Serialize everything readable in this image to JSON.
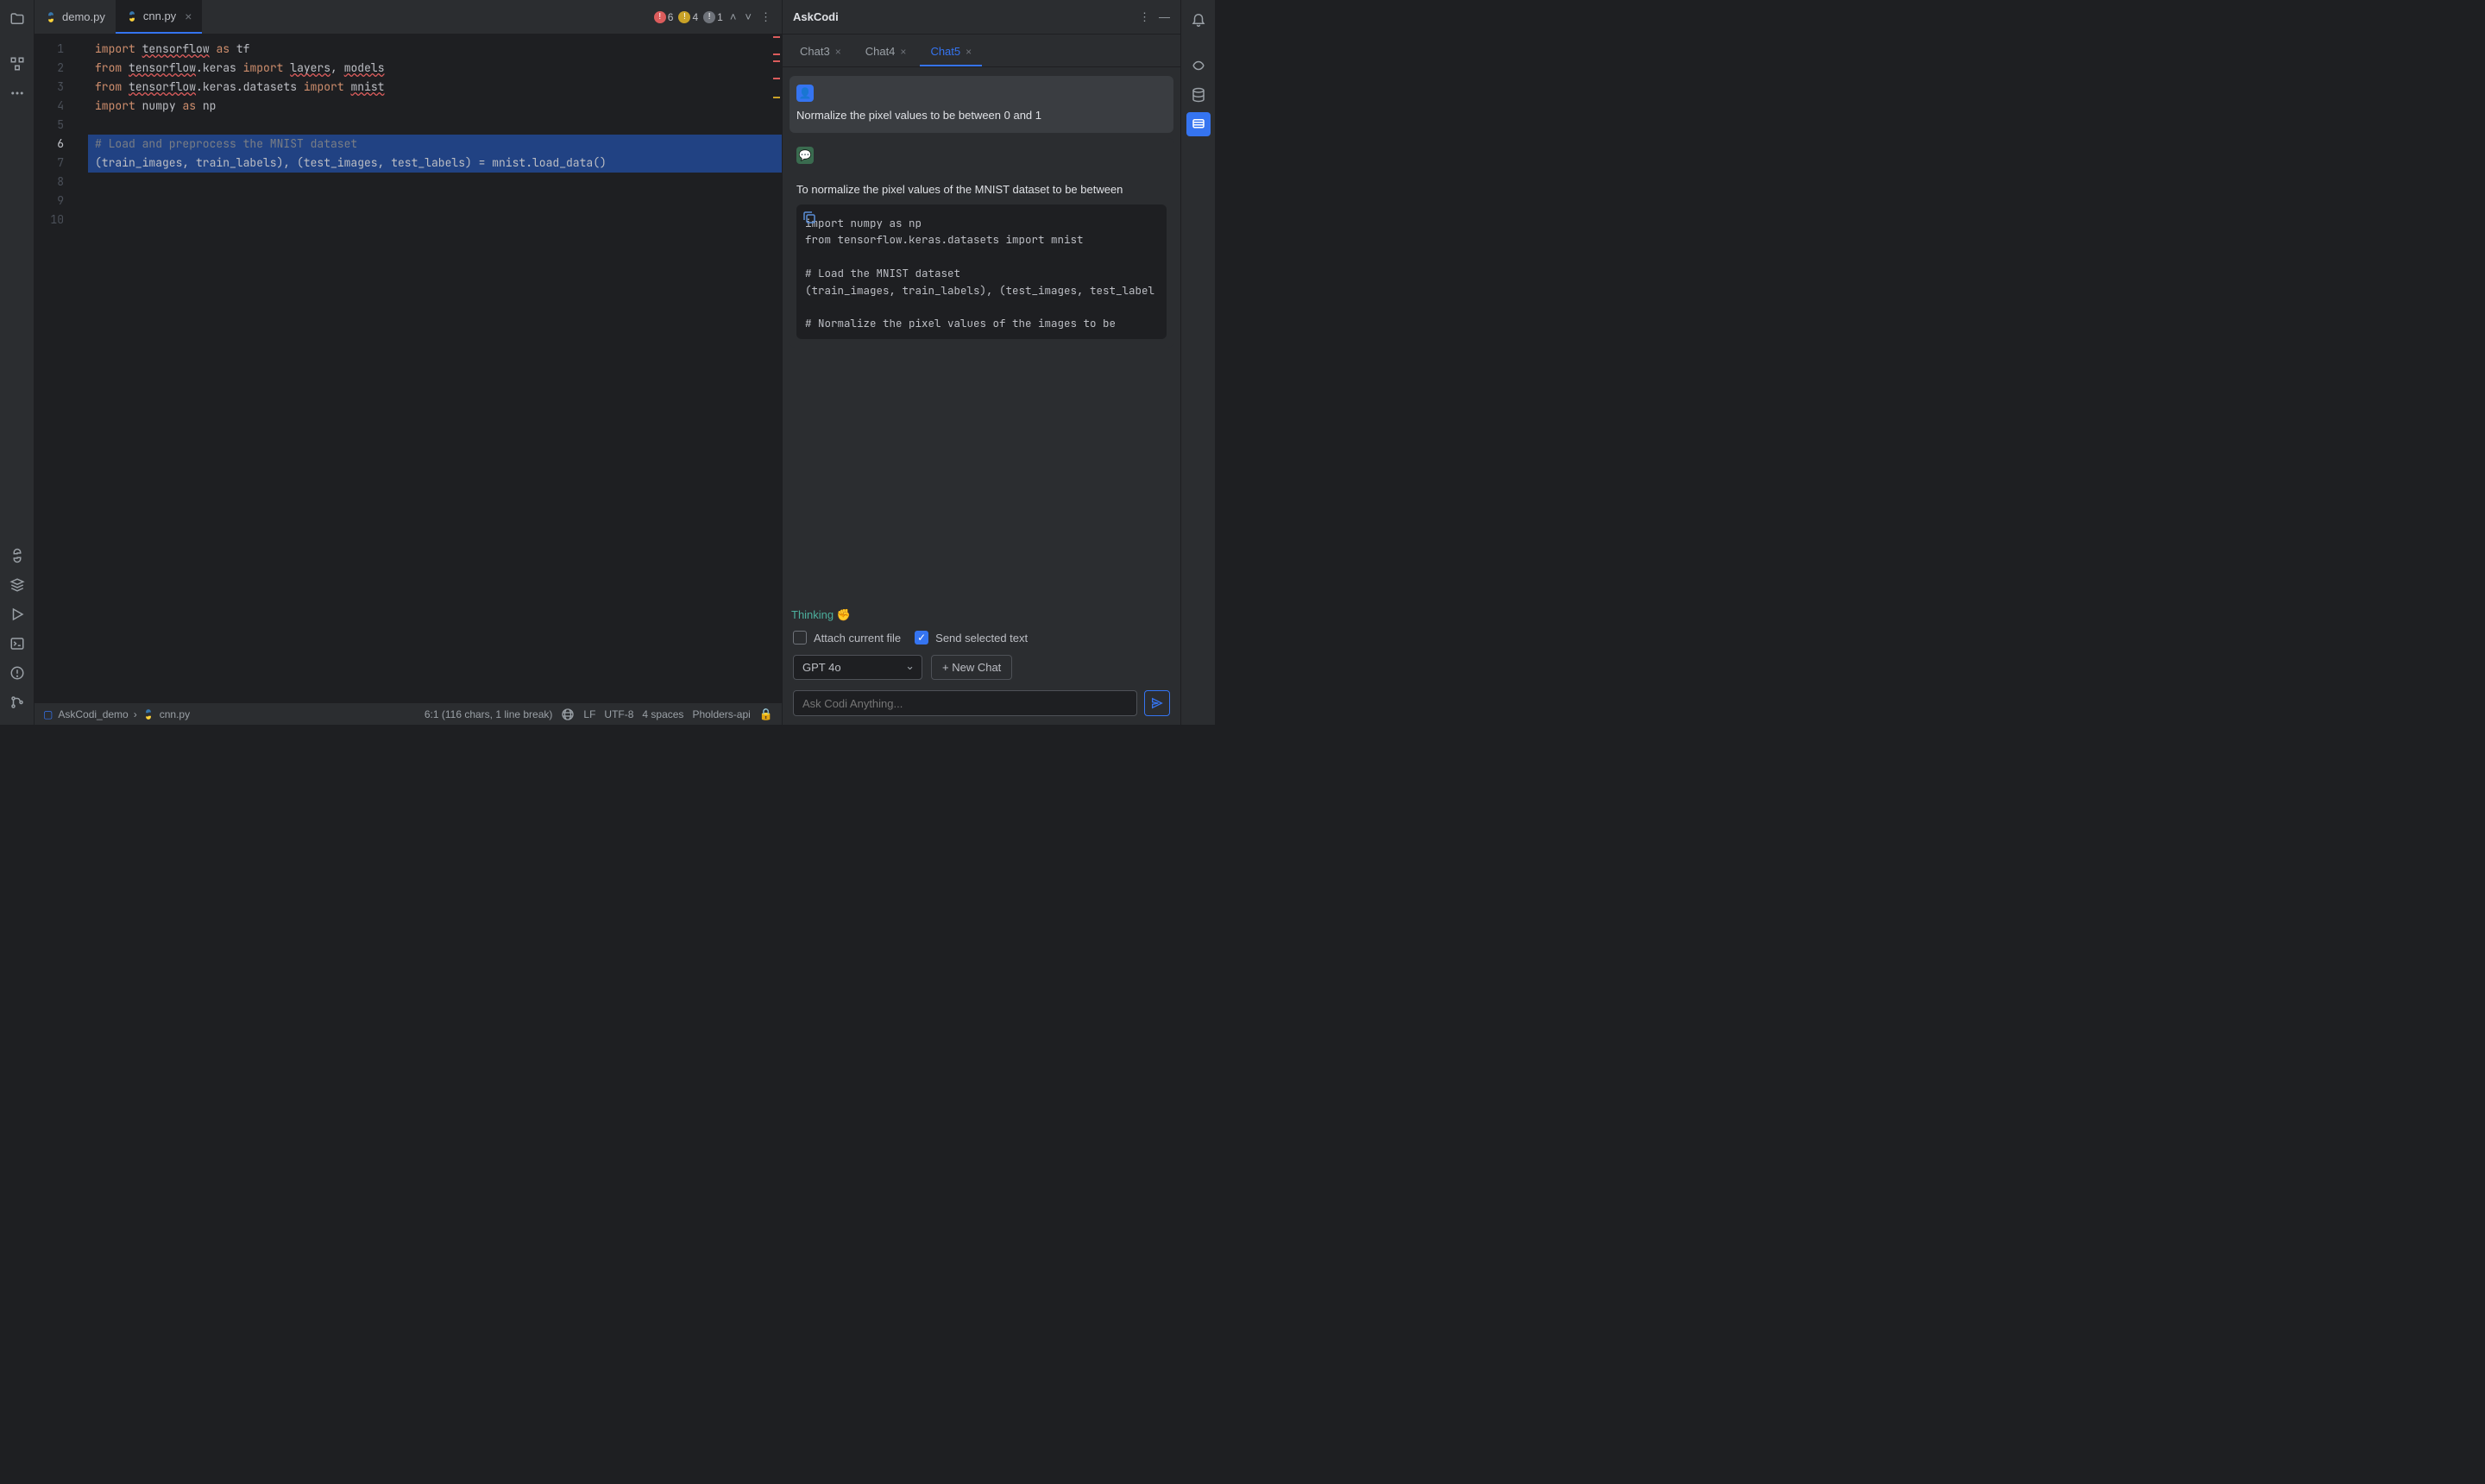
{
  "tabs": {
    "files": [
      {
        "label": "demo.py",
        "active": false,
        "closable": false
      },
      {
        "label": "cnn.py",
        "active": true,
        "closable": true
      }
    ],
    "errors": {
      "red": "6",
      "yellow": "4",
      "gray": "1"
    }
  },
  "lines": [
    "1",
    "2",
    "3",
    "4",
    "5",
    "6",
    "7",
    "8",
    "9",
    "10"
  ],
  "code": {
    "l1_kw1": "import",
    "l1_id1": "tensorflow",
    "l1_kw2": "as",
    "l1_id2": "tf",
    "l2_kw1": "from",
    "l2_id1": "tensorflow",
    "l2_txt1": ".keras ",
    "l2_kw2": "import",
    "l2_id2": "layers",
    "l2_comma": ", ",
    "l2_id3": "models",
    "l3_kw1": "from",
    "l3_id1": "tensorflow",
    "l3_txt1": ".keras.datasets ",
    "l3_kw2": "import",
    "l3_id2": "mnist",
    "l4_kw1": "import",
    "l4_id1": "numpy",
    "l4_kw2": "as",
    "l4_id2": "np",
    "l6": "# Load and preprocess the MNIST dataset",
    "l7": "(train_images, train_labels), (test_images, test_labels) = mnist.load_data()"
  },
  "panel": {
    "title": "AskCodi",
    "tabs": [
      {
        "label": "Chat3"
      },
      {
        "label": "Chat4"
      },
      {
        "label": "Chat5",
        "active": true
      }
    ],
    "user_msg": "Normalize the pixel values to be between 0 and 1",
    "assistant_intro": "To normalize the pixel values of the MNIST dataset to be between",
    "code_block": "import numpy as np\nfrom tensorflow.keras.datasets import mnist\n\n# Load the MNIST dataset\n(train_images, train_labels), (test_images, test_label\n\n# Normalize the pixel values of the images to be",
    "thinking": "Thinking",
    "thinking_emoji": "✊",
    "attach_label": "Attach current file",
    "send_sel_label": "Send selected text",
    "model": "GPT 4o",
    "new_chat": "+ New Chat",
    "placeholder": "Ask Codi Anything..."
  },
  "status": {
    "project": "AskCodi_demo",
    "file": "cnn.py",
    "pos": "6:1 (116 chars, 1 line break)",
    "lf": "LF",
    "enc": "UTF-8",
    "indent": "4 spaces",
    "api": "Pholders-api"
  }
}
